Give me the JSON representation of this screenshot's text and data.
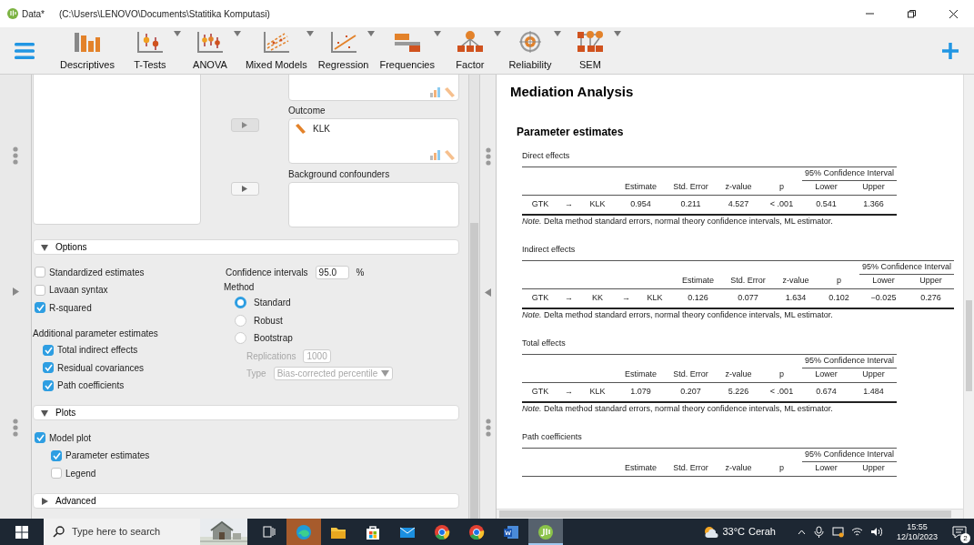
{
  "window": {
    "title": "Data*",
    "path": "(C:\\Users\\LENOVO\\Documents\\Statitika Komputasi)"
  },
  "toolbar": [
    {
      "label": "Descriptives",
      "has_menu": false
    },
    {
      "label": "T-Tests",
      "has_menu": true
    },
    {
      "label": "ANOVA",
      "has_menu": true
    },
    {
      "label": "Mixed Models",
      "has_menu": true
    },
    {
      "label": "Regression",
      "has_menu": true
    },
    {
      "label": "Frequencies",
      "has_menu": true
    },
    {
      "label": "Factor",
      "has_menu": true
    },
    {
      "label": "Reliability",
      "has_menu": true
    },
    {
      "label": "SEM",
      "has_menu": true
    }
  ],
  "form": {
    "target_boxes": [
      {
        "label": "Outcome",
        "items": [
          {
            "name": "KLK"
          }
        ],
        "arrow_disabled": true
      },
      {
        "label": "Background confounders",
        "arrow_disabled": false
      }
    ],
    "sections": [
      {
        "kind": "options",
        "title": "Options",
        "expanded": true,
        "left": [
          {
            "kind": "checkbox",
            "label": "Standardized estimates",
            "checked": false
          },
          {
            "kind": "checkbox",
            "label": "Lavaan syntax",
            "checked": false
          },
          {
            "kind": "checkbox",
            "label": "R-squared",
            "checked": true
          },
          {
            "kind": "group",
            "label": "Additional parameter estimates",
            "children": [
              {
                "kind": "checkbox",
                "label": "Total indirect effects",
                "checked": true
              },
              {
                "kind": "checkbox",
                "label": "Residual covariances",
                "checked": true
              },
              {
                "kind": "checkbox",
                "label": "Path coefficients",
                "checked": true
              }
            ]
          }
        ],
        "right": {
          "ci": {
            "label": "Confidence intervals",
            "value": "95.0",
            "unit": "%"
          },
          "method": {
            "label": "Method",
            "options": [
              {
                "label": "Standard",
                "selected": true
              },
              {
                "label": "Robust",
                "selected": false
              },
              {
                "label": "Bootstrap",
                "selected": false
              }
            ]
          },
          "bootstrap": [
            {
              "kind": "input",
              "label": "Replications",
              "value": "1000",
              "disabled": true
            },
            {
              "kind": "select",
              "label": "Type",
              "value": "Bias-corrected percentile",
              "disabled": true
            }
          ]
        }
      },
      {
        "kind": "plots",
        "title": "Plots",
        "expanded": true,
        "items": [
          {
            "kind": "checkbox",
            "label": "Model plot",
            "checked": true,
            "children": [
              {
                "kind": "checkbox",
                "label": "Parameter estimates",
                "checked": true
              },
              {
                "kind": "checkbox",
                "label": "Legend",
                "checked": false
              }
            ]
          }
        ]
      },
      {
        "kind": "collapsed",
        "title": "Advanced",
        "expanded": false
      }
    ]
  },
  "results": {
    "title": "Mediation Analysis",
    "subtitle": "Parameter estimates",
    "tables": [
      {
        "title": "Direct effects",
        "ci_header": "95% Confidence Interval",
        "columns": [
          "Estimate",
          "Std. Error",
          "z-value",
          "p",
          "Lower",
          "Upper"
        ],
        "rows": [
          {
            "path": [
              "GTK",
              "→",
              "KLK"
            ],
            "values": [
              "0.954",
              "0.211",
              "4.527",
              "< .001",
              "0.541",
              "1.366"
            ]
          }
        ],
        "note": "*Note.* Delta method standard errors, normal theory confidence intervals, ML estimator."
      },
      {
        "title": "Indirect effects",
        "ci_header": "95% Confidence Interval",
        "columns": [
          "Estimate",
          "Std. Error",
          "z-value",
          "p",
          "Lower",
          "Upper"
        ],
        "rows": [
          {
            "path": [
              "GTK",
              "→",
              "KK",
              "→",
              "KLK"
            ],
            "values": [
              "0.126",
              "0.077",
              "1.634",
              "0.102",
              "−0.025",
              "0.276"
            ]
          }
        ],
        "note": "*Note.* Delta method standard errors, normal theory confidence intervals, ML estimator."
      },
      {
        "title": "Total effects",
        "ci_header": "95% Confidence Interval",
        "columns": [
          "Estimate",
          "Std. Error",
          "z-value",
          "p",
          "Lower",
          "Upper"
        ],
        "rows": [
          {
            "path": [
              "GTK",
              "→",
              "KLK"
            ],
            "values": [
              "1.079",
              "0.207",
              "5.226",
              "< .001",
              "0.674",
              "1.484"
            ]
          }
        ],
        "note": "*Note.* Delta method standard errors, normal theory confidence intervals, ML estimator."
      },
      {
        "title": "Path coefficients",
        "ci_header": "95% Confidence Interval",
        "columns": [
          "Estimate",
          "Std. Error",
          "z-value",
          "p",
          "Lower",
          "Upper"
        ]
      }
    ]
  },
  "taskbar": {
    "search_placeholder": "Type here to search",
    "apps": [
      {
        "selected": false,
        "flashing": true
      },
      {
        "selected": false,
        "flashing": false
      },
      {
        "selected": false,
        "flashing": false
      },
      {
        "selected": false,
        "flashing": false
      },
      {
        "selected": false,
        "flashing": false
      },
      {
        "selected": false,
        "flashing": false
      },
      {
        "selected": false,
        "flashing": false
      },
      {
        "selected": true,
        "flashing": false
      }
    ],
    "weather": {
      "temperature": "33°C",
      "condition": "Cerah"
    },
    "clock": {
      "time": "15:55",
      "date": "12/10/2023"
    },
    "notifications": "2"
  }
}
